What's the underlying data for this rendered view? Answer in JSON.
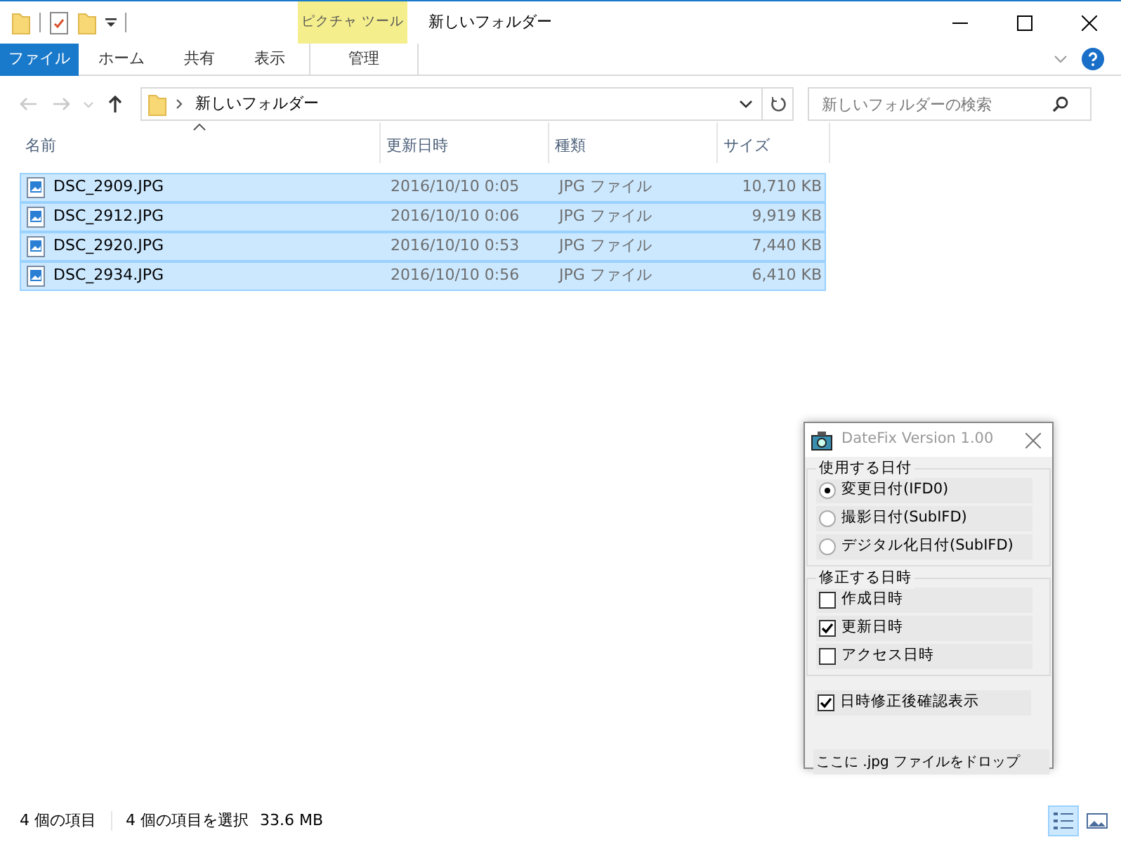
{
  "window": {
    "title": "新しいフォルダー",
    "context_tab": "ピクチャ ツール"
  },
  "ribbon_tabs": [
    {
      "label": "ファイル",
      "kind": "file"
    },
    {
      "label": "ホーム",
      "kind": "normal"
    },
    {
      "label": "共有",
      "kind": "normal"
    },
    {
      "label": "表示",
      "kind": "normal"
    },
    {
      "label": "管理",
      "kind": "context"
    }
  ],
  "nav": [
    {
      "kind": "back",
      "disabled": true
    },
    {
      "kind": "forward",
      "disabled": true
    },
    {
      "kind": "recent",
      "disabled": true
    },
    {
      "kind": "up",
      "disabled": false
    }
  ],
  "address": {
    "path": "新しいフォルダー"
  },
  "search": {
    "placeholder": "新しいフォルダーの検索"
  },
  "columns": [
    {
      "label": "名前",
      "sorted": true
    },
    {
      "label": "更新日時",
      "sorted": false
    },
    {
      "label": "種類",
      "sorted": false
    },
    {
      "label": "サイズ",
      "sorted": false
    }
  ],
  "files": [
    {
      "name": "DSC_2909.JPG",
      "modified": "2016/10/10 0:05",
      "type": "JPG ファイル",
      "size": "10,710 KB",
      "selected": true
    },
    {
      "name": "DSC_2912.JPG",
      "modified": "2016/10/10 0:06",
      "type": "JPG ファイル",
      "size": "9,919 KB",
      "selected": true
    },
    {
      "name": "DSC_2920.JPG",
      "modified": "2016/10/10 0:53",
      "type": "JPG ファイル",
      "size": "7,440 KB",
      "selected": true
    },
    {
      "name": "DSC_2934.JPG",
      "modified": "2016/10/10 0:56",
      "type": "JPG ファイル",
      "size": "6,410 KB",
      "selected": true
    }
  ],
  "status_bar": {
    "item_count": "4 個の項目",
    "selection": "4 個の項目を選択",
    "size": "33.6 MB"
  },
  "view_buttons": [
    {
      "kind": "details",
      "selected": true
    },
    {
      "kind": "large-icons",
      "selected": false
    }
  ],
  "dialog": {
    "title": "DateFix Version 1.00",
    "groups": [
      {
        "label": "使用する日付",
        "options": [
          {
            "kind": "radio",
            "label": "変更日付(IFD0)",
            "selected": true
          },
          {
            "kind": "radio",
            "label": "撮影日付(SubIFD)",
            "selected": false
          },
          {
            "kind": "radio",
            "label": "デジタル化日付(SubIFD)",
            "selected": false
          }
        ]
      },
      {
        "label": "修正する日時",
        "options": [
          {
            "kind": "checkbox",
            "label": "作成日時",
            "checked": false
          },
          {
            "kind": "checkbox",
            "label": "更新日時",
            "checked": true
          },
          {
            "kind": "checkbox",
            "label": "アクセス日時",
            "checked": false
          }
        ]
      }
    ],
    "confirm": {
      "label": "日時修正後確認表示",
      "checked": true
    },
    "drop_hint": "ここに .jpg ファイルをドロップ"
  }
}
